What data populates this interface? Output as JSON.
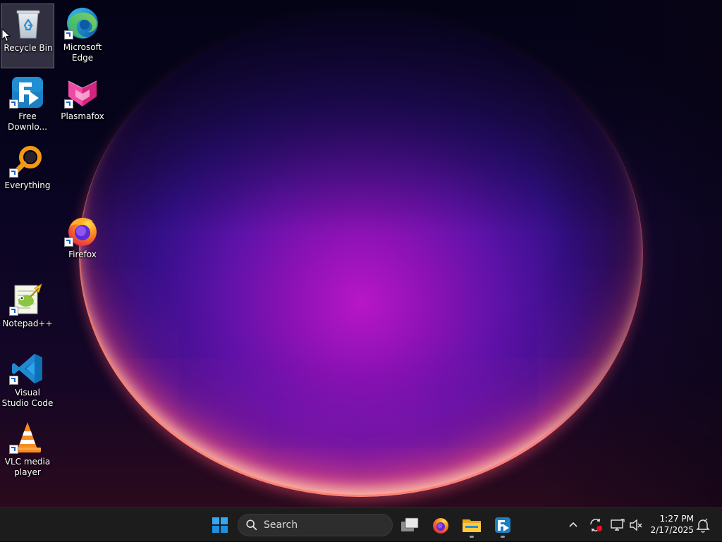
{
  "desktop": {
    "icons": [
      {
        "label": "Recycle Bin",
        "icon": "recycle-bin-icon",
        "selected": true
      },
      {
        "label": "Microsoft Edge",
        "icon": "edge-icon"
      },
      {
        "label": "Free Downlo...",
        "icon": "free-download-manager-icon"
      },
      {
        "label": "Plasmafox",
        "icon": "plasmafox-icon"
      },
      {
        "label": "Everything",
        "icon": "everything-search-icon"
      },
      {
        "label": "Firefox",
        "icon": "firefox-icon"
      },
      {
        "label": "Notepad++",
        "icon": "notepad-plus-plus-icon"
      },
      {
        "label": "Visual Studio Code",
        "icon": "vscode-icon"
      },
      {
        "label": "VLC media player",
        "icon": "vlc-icon"
      }
    ]
  },
  "taskbar": {
    "start_icon": "windows-start-icon",
    "search": {
      "placeholder": "Search",
      "icon": "magnifier-icon"
    },
    "pinned": [
      {
        "name": "Task View",
        "icon": "task-view-icon",
        "running": false
      },
      {
        "name": "Firefox",
        "icon": "firefox-icon",
        "running": false
      },
      {
        "name": "File Explorer",
        "icon": "file-explorer-icon",
        "running": true
      },
      {
        "name": "Free Download Manager",
        "icon": "free-download-manager-icon",
        "running": true
      }
    ],
    "tray": {
      "icons": [
        "chevron-up-icon",
        "sync-error-icon",
        "network-icon",
        "volume-muted-icon",
        "notification-icon"
      ],
      "time": "1:27 PM",
      "date": "2/17/2025"
    }
  },
  "colors": {
    "taskbar_bg": "#1c1c1c",
    "accent_blue": "#0078d4",
    "wallpaper_magenta": "#b816c7"
  }
}
